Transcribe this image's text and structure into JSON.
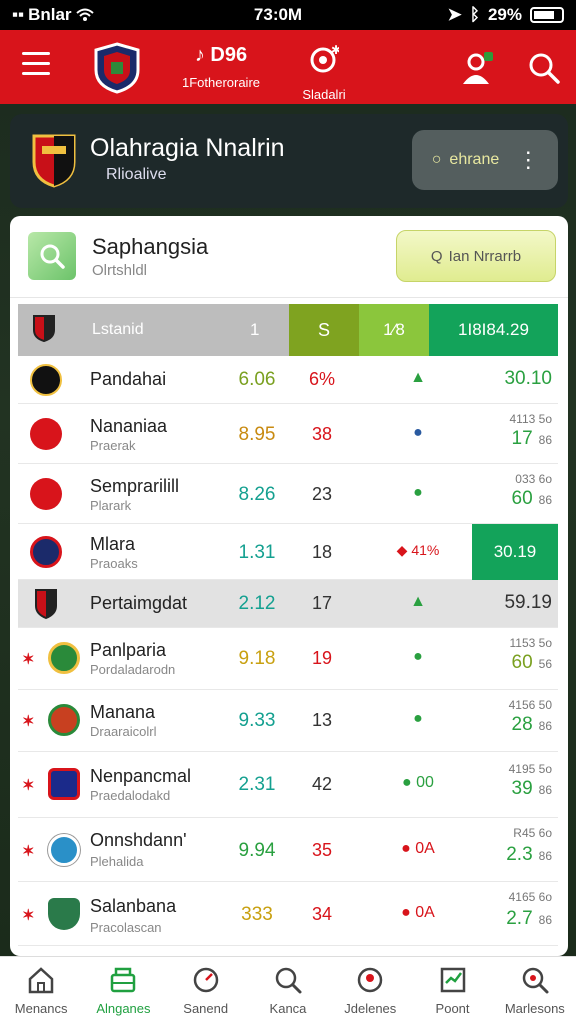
{
  "status_bar": {
    "carrier": "Bnlar",
    "time": "73:0M",
    "battery": "29%"
  },
  "top_nav": {
    "stat_value": "D96",
    "stat_label": "1Fotheroraire",
    "stadium_label": "Sladalri"
  },
  "hero": {
    "title": "Olahragia Nnalrin",
    "subtitle": "Rlioalive",
    "button_label": "ehrane"
  },
  "card": {
    "title": "Saphangsia",
    "subtitle": "Olrtshldl",
    "button_label": "Ian Nrrarrb"
  },
  "table": {
    "header": {
      "team": "Lstanid",
      "col1": "1",
      "col2": "S",
      "col3": "1⁄8",
      "col4": "1I8I84.29"
    },
    "rows": [
      {
        "name": "Pandahai",
        "sub": "",
        "v1": "6.06",
        "v2": "6%",
        "ind": "▲",
        "rtop": "",
        "rbot": "30.10",
        "rsmall": ""
      },
      {
        "name": "Nananiaa",
        "sub": "Praerak",
        "v1": "8.95",
        "v2": "38",
        "ind": "●",
        "rtop": "4113 5o",
        "rbot": "17",
        "rsmall": "86"
      },
      {
        "name": "Semprarilill",
        "sub": "Plarark",
        "v1": "8.26",
        "v2": "23",
        "ind": "●",
        "rtop": "033 6o",
        "rbot": "60",
        "rsmall": "86"
      },
      {
        "name": "Mlara",
        "sub": "Praoaks",
        "v1": "1.31",
        "v2": "18",
        "ind": "◆ 41%",
        "rtop": "",
        "rbot": "30.19",
        "rsmall": ""
      },
      {
        "name": "Pertaimgdat",
        "sub": "",
        "v1": "2.12",
        "v2": "17",
        "ind": "▲",
        "rtop": "",
        "rbot": "59.19",
        "rsmall": ""
      },
      {
        "name": "Panlparia",
        "sub": "Pordaladarodn",
        "v1": "9.18",
        "v2": "19",
        "ind": "●",
        "rtop": "1153 5o",
        "rbot": "60",
        "rsmall": "56"
      },
      {
        "name": "Manana",
        "sub": "Draaraicolrl",
        "v1": "9.33",
        "v2": "13",
        "ind": "●",
        "rtop": "4156 50",
        "rbot": "28",
        "rsmall": "86"
      },
      {
        "name": "Nenpancmal",
        "sub": "Praedalodakd",
        "v1": "2.31",
        "v2": "42",
        "ind": "● 00",
        "rtop": "4195 5o",
        "rbot": "39",
        "rsmall": "86"
      },
      {
        "name": "Onnshdann'",
        "sub": "Plehalida",
        "v1": "9.94",
        "v2": "35",
        "ind": "● 0A",
        "rtop": "R45 6o",
        "rbot": "2.3",
        "rsmall": "86"
      },
      {
        "name": "Salanbana",
        "sub": "Pracolascan",
        "v1": "333",
        "v2": "34",
        "ind": "● 0A",
        "rtop": "4165 6o",
        "rbot": "2.7",
        "rsmall": "86"
      }
    ]
  },
  "bottom_nav": [
    {
      "label": "Menancs"
    },
    {
      "label": "Alnganes"
    },
    {
      "label": "Sanend"
    },
    {
      "label": "Kanca"
    },
    {
      "label": "Jdelenes"
    },
    {
      "label": "Poont"
    },
    {
      "label": "Marlesons"
    }
  ]
}
